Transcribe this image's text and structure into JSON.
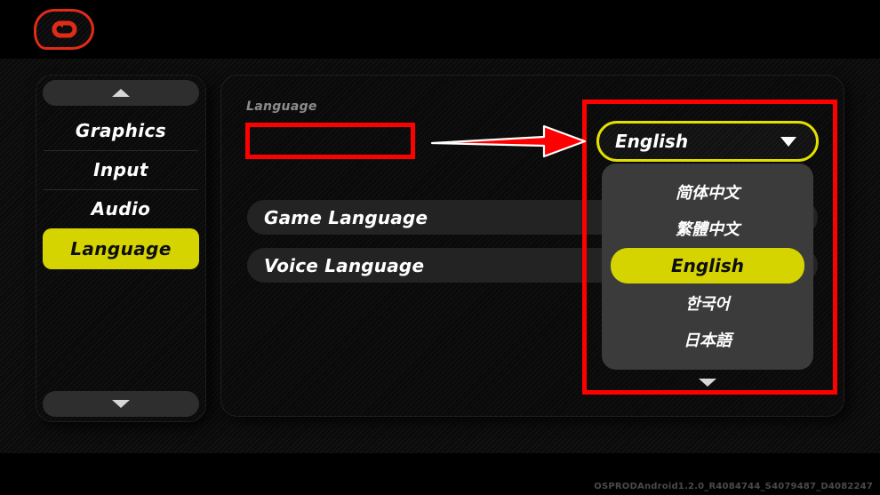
{
  "header": {
    "back_icon": "back-arrow-icon"
  },
  "sidebar": {
    "scroll_up_icon": "chevron-up-icon",
    "scroll_down_icon": "chevron-down-icon",
    "items": [
      {
        "label": "Graphics",
        "selected": false
      },
      {
        "label": "Input",
        "selected": false
      },
      {
        "label": "Audio",
        "selected": false
      },
      {
        "label": "Language",
        "selected": true
      }
    ]
  },
  "main": {
    "section_title": "Language",
    "rows": [
      {
        "label": "Game Language"
      },
      {
        "label": "Voice Language"
      }
    ]
  },
  "dropdown": {
    "value": "English",
    "caret_icon": "chevron-down-icon",
    "more_icon": "chevron-down-icon",
    "options": [
      {
        "label": "简体中文",
        "selected": false
      },
      {
        "label": "繁體中文",
        "selected": false
      },
      {
        "label": "English",
        "selected": true
      },
      {
        "label": "한국어",
        "selected": false
      },
      {
        "label": "日本語",
        "selected": false
      }
    ]
  },
  "annotations": {
    "color": "#ff0000",
    "arrow_icon": "right-arrow-annotation",
    "box_game_language": "Game Language",
    "box_dropdown": "English"
  },
  "footer": {
    "build_id": "OSPRODAndroid1.2.0_R4084744_S4079487_D4082247"
  },
  "colors": {
    "accent_yellow": "#d6d400",
    "annotation_red": "#ff0000",
    "back_red": "#e02b18"
  }
}
